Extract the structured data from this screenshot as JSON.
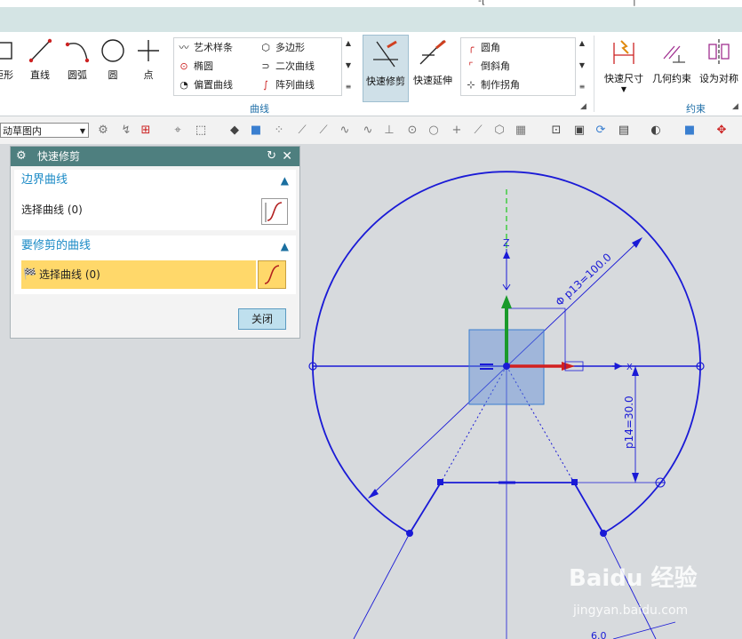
{
  "titlebar": {
    "fragment_1": "-[",
    "fragment_2": "|"
  },
  "ribbon": {
    "buttons": {
      "rect": "矩形",
      "line": "直线",
      "arc": "圆弧",
      "circle": "圆",
      "point": "点",
      "quick_trim": "快速修剪",
      "quick_extend": "快速延伸",
      "quick_dim": "快速尺寸",
      "geo_constraint": "几何约束",
      "set_symmetric": "设为对称"
    },
    "curve_gallery": [
      "艺术样条",
      "多边形",
      "椭圆",
      "二次曲线",
      "偏置曲线",
      "阵列曲线"
    ],
    "corner_gallery": [
      "圆角",
      "倒斜角",
      "制作拐角"
    ],
    "group_curve": "曲线",
    "group_constraint": "约束"
  },
  "toolbar": {
    "combo_value": "动草图内"
  },
  "dialog": {
    "title": "快速修剪",
    "section1": {
      "title": "边界曲线",
      "row": "选择曲线 (0)"
    },
    "section2": {
      "title": "要修剪的曲线",
      "row": "选择曲线 (0)"
    },
    "close_label": "关闭"
  },
  "sketch": {
    "axis_label": "Z",
    "x_label": "X",
    "dim_diameter": "p13=100.0",
    "dim_diameter_symbol": "Φ",
    "dim_vertical": "p14=30.0",
    "bottom_dim": "6.0"
  },
  "watermark": {
    "brand": "Baidu 经验",
    "url": "jingyan.baidu.com"
  },
  "colors": {
    "sketch_blue": "#1a1ad6",
    "z_green": "#1a9a2a",
    "x_red": "#d22020",
    "dialog_header": "#4e7f7f",
    "active_row": "#ffd86a"
  }
}
